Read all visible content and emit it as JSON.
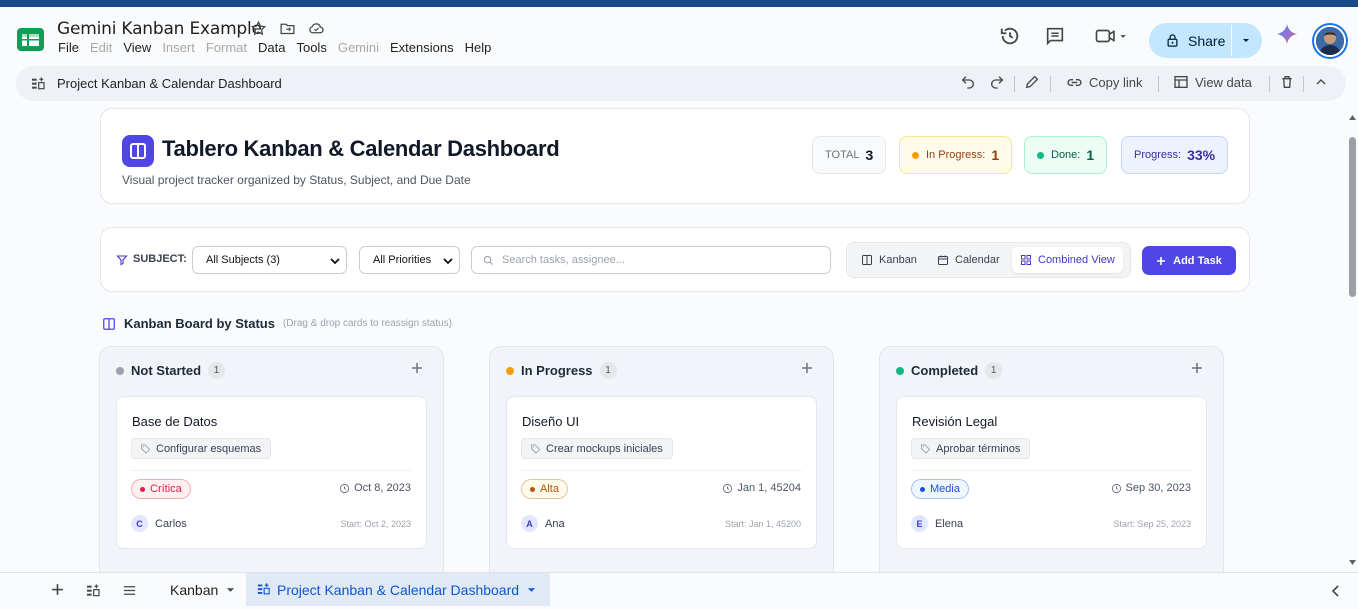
{
  "app": {
    "doc_title": "Gemini Kanban Example",
    "menu": [
      {
        "label": "File",
        "enabled": true
      },
      {
        "label": "Edit",
        "enabled": false
      },
      {
        "label": "View",
        "enabled": true
      },
      {
        "label": "Insert",
        "enabled": false
      },
      {
        "label": "Format",
        "enabled": false
      },
      {
        "label": "Data",
        "enabled": true
      },
      {
        "label": "Tools",
        "enabled": true
      },
      {
        "label": "Gemini",
        "enabled": false
      },
      {
        "label": "Extensions",
        "enabled": true
      },
      {
        "label": "Help",
        "enabled": true
      }
    ],
    "share_label": "Share"
  },
  "embed": {
    "title": "Project Kanban & Calendar Dashboard",
    "copy_link": "Copy link",
    "view_data": "View data"
  },
  "header": {
    "title": "Tablero Kanban & Calendar Dashboard",
    "subtitle": "Visual project tracker organized by Status, Subject, and Due Date",
    "stats": {
      "total_label": "TOTAL",
      "total_value": "3",
      "inprogress_label": "In Progress:",
      "inprogress_value": "1",
      "done_label": "Done:",
      "done_value": "1",
      "progress_label": "Progress:",
      "progress_value": "33%"
    }
  },
  "filters": {
    "subject_label": "SUBJECT:",
    "subject_value": "All Subjects (3)",
    "priority_value": "All Priorities",
    "search_placeholder": "Search tasks, assignee...",
    "views": [
      "Kanban",
      "Calendar",
      "Combined View"
    ],
    "active_view": "Combined View",
    "add_task": "Add Task"
  },
  "board": {
    "title": "Kanban Board by Status",
    "hint": "(Drag & drop cards to reassign status)",
    "columns": [
      {
        "name": "Not Started",
        "count": "1",
        "color": "#9ca3af",
        "task": {
          "title": "Base de Datos",
          "tag": "Configurar esquemas",
          "priority": "Crítica",
          "priority_color": "#e11d48",
          "priority_bg": "#fff1f2",
          "due": "Oct 8, 2023",
          "initial": "C",
          "assignee": "Carlos",
          "start": "Start: Oct 2, 2023"
        }
      },
      {
        "name": "In Progress",
        "count": "1",
        "color": "#f59e0b",
        "task": {
          "title": "Diseño UI",
          "tag": "Crear mockups iniciales",
          "priority": "Alta",
          "priority_color": "#b45309",
          "priority_bg": "#fffbeb",
          "due": "Jan 1, 45204",
          "initial": "A",
          "assignee": "Ana",
          "start": "Start: Jan 1, 45200"
        }
      },
      {
        "name": "Completed",
        "count": "1",
        "color": "#10b981",
        "task": {
          "title": "Revisión Legal",
          "tag": "Aprobar términos",
          "priority": "Media",
          "priority_color": "#1d4ed8",
          "priority_bg": "#eff6ff",
          "due": "Sep 30, 2023",
          "initial": "E",
          "assignee": "Elena",
          "start": "Start: Sep 25, 2023"
        }
      }
    ]
  },
  "sheets": {
    "tabs": [
      "Kanban",
      "Project Kanban & Calendar Dashboard"
    ],
    "active": "Project Kanban & Calendar Dashboard"
  }
}
